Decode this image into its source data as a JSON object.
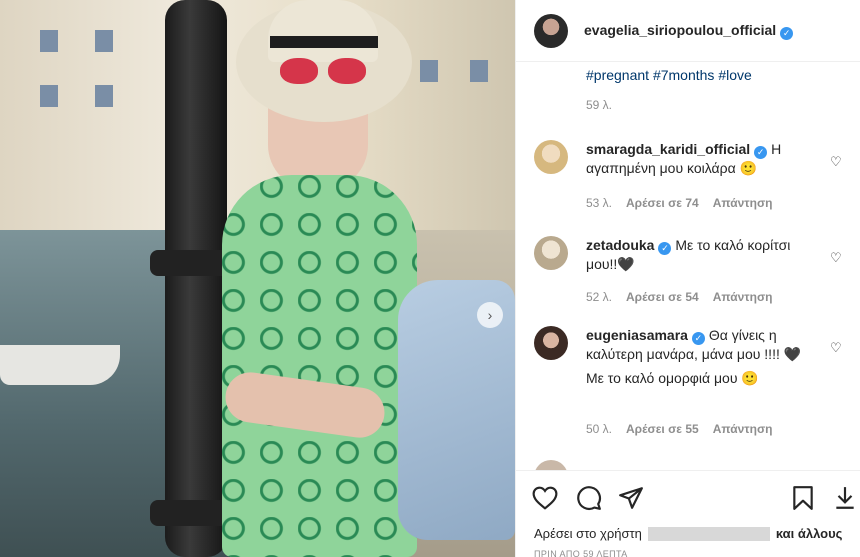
{
  "post": {
    "username": "evagelia_siriopoulou_official",
    "caption_tags": "#pregnant #7months #love",
    "caption_time": "59 λ."
  },
  "comments": [
    {
      "username": "smaragda_karidi_official",
      "text": "Η αγαπημένη μου κοιλάρα 🙂",
      "time": "53 λ.",
      "likes": "Αρέσει σε 74",
      "reply": "Απάντηση",
      "avatar_color": "#e7d1a6"
    },
    {
      "username": "zetadouka",
      "text": "Με το καλό κορίτσι μου!!🖤",
      "time": "52 λ.",
      "likes": "Αρέσει σε 54",
      "reply": "Απάντηση",
      "avatar_color": "#d9cdb6"
    },
    {
      "username": "eugeniasamara",
      "text": "Θα γίνεις η καλύτερη μανάρα, μάνα μου !!!! 🖤",
      "text2": "Με το καλό ομορφιά μου 🙂",
      "time": "50 λ.",
      "likes": "Αρέσει σε 55",
      "reply": "Απάντηση",
      "avatar_color": "#8a6a5c"
    }
  ],
  "likes_line": {
    "prefix": "Αρέσει στο χρήστη",
    "suffix": "και άλλους"
  },
  "posted_label": "ΠΡΙΝ ΑΠΟ 59 ΛΕΠΤΑ",
  "colors": {
    "verified": "#3897f0",
    "hashtag": "#00376b",
    "muted": "#8e8e8e"
  }
}
